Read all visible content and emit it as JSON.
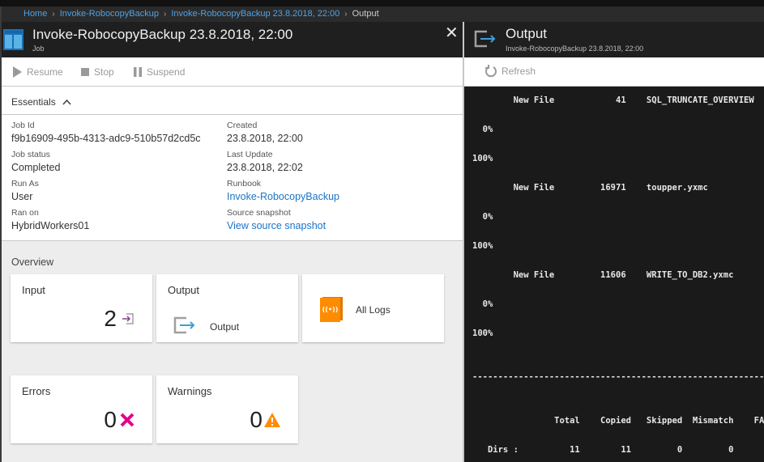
{
  "breadcrumb": {
    "items": [
      "Home",
      "Invoke-RobocopyBackup",
      "Invoke-RobocopyBackup 23.8.2018, 22:00"
    ],
    "current": "Output",
    "separator": "›"
  },
  "job_blade": {
    "title": "Invoke-RobocopyBackup 23.8.2018, 22:00",
    "subtitle": "Job",
    "close_icon": "✕",
    "commands": [
      {
        "label": "Resume",
        "icon": "play-icon"
      },
      {
        "label": "Stop",
        "icon": "stop-icon"
      },
      {
        "label": "Suspend",
        "icon": "pause-icon"
      }
    ],
    "essentials": {
      "label": "Essentials",
      "left": [
        {
          "label": "Job Id",
          "value": "f9b16909-495b-4313-adc9-510b57d2cd5c"
        },
        {
          "label": "Job status",
          "value": "Completed"
        },
        {
          "label": "Run As",
          "value": "User"
        },
        {
          "label": "Ran on",
          "value": "HybridWorkers01"
        }
      ],
      "right": [
        {
          "label": "Created",
          "value": "23.8.2018, 22:00"
        },
        {
          "label": "Last Update",
          "value": "23.8.2018, 22:02"
        },
        {
          "label": "Runbook",
          "value": "Invoke-RobocopyBackup"
        },
        {
          "label": "Source snapshot",
          "value": "View source snapshot"
        }
      ]
    },
    "overview": {
      "label": "Overview",
      "tiles": {
        "input": {
          "title": "Input",
          "count": "2"
        },
        "output": {
          "title": "Output",
          "sub": "Output"
        },
        "logs": {
          "title": "All Logs"
        },
        "errors": {
          "title": "Errors",
          "count": "0"
        },
        "warnings": {
          "title": "Warnings",
          "count": "0"
        }
      }
    },
    "colors": {
      "error": "#e3008c",
      "warning": "#ff8c00",
      "logs": "#ff8c00",
      "link": "#1a73c7",
      "accent_blue": "#3aa0d8"
    }
  },
  "output_blade": {
    "title": "Output",
    "subtitle": "Invoke-RobocopyBackup 23.8.2018, 22:00",
    "refresh_label": "Refresh",
    "console_lines": [
      "        New File            41    SQL_TRUNCATE_OVERVIEW",
      "  0%",
      "100%",
      "        New File         16971    toupper.yxmc",
      "  0%",
      "100%",
      "        New File         11606    WRITE_TO_DB2.yxmc",
      "  0%",
      "100%",
      "------------------------------------------------------------------------",
      "                Total    Copied   Skipped  Mismatch    FAILED",
      "   Dirs :          11        11         0         0"
    ]
  }
}
